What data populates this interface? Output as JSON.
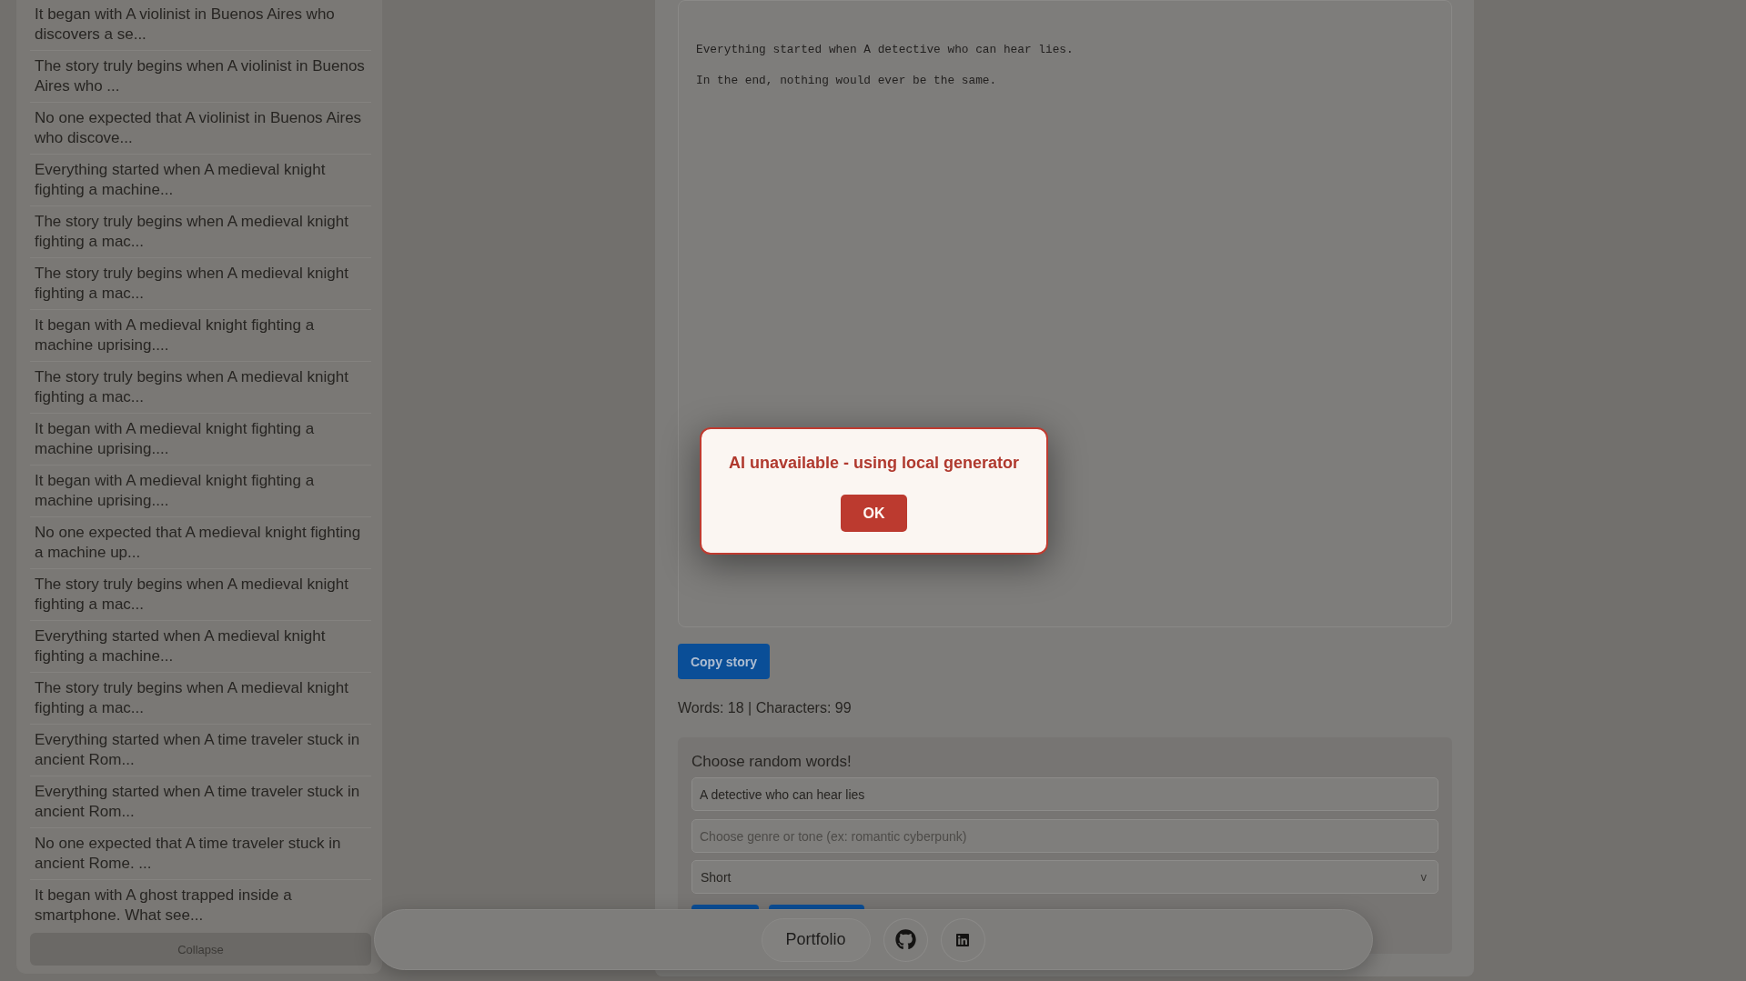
{
  "sidebar": {
    "items": [
      "It began with A violinist in Buenos Aires who discovers a se...",
      "The story truly begins when A violinist in Buenos Aires who ...",
      "No one expected that A violinist in Buenos Aires who discove...",
      "Everything started when A medieval knight fighting a machine...",
      "The story truly begins when A medieval knight fighting a mac...",
      "The story truly begins when A medieval knight fighting a mac...",
      "It began with A medieval knight fighting a machine uprising....",
      "The story truly begins when A medieval knight fighting a mac...",
      "It began with A medieval knight fighting a machine uprising....",
      "It began with A medieval knight fighting a machine uprising....",
      "No one expected that A medieval knight fighting a machine up...",
      "The story truly begins when A medieval knight fighting a mac...",
      "Everything started when A medieval knight fighting a machine...",
      "The story truly begins when A medieval knight fighting a mac...",
      "Everything started when A time traveler stuck in ancient Rom...",
      "Everything started when A time traveler stuck in ancient Rom...",
      "No one expected that A time traveler stuck in ancient Rome. ...",
      "It began with A ghost trapped inside a smartphone. What see..."
    ],
    "collapse_button": "Collapse"
  },
  "story": {
    "paragraphs": [
      "Everything started when A detective who can hear lies.",
      "In the end, nothing would ever be the same."
    ]
  },
  "copy_button": "Copy story",
  "stats": "Words: 18 | Characters: 99",
  "generator": {
    "title": "Choose random words!",
    "prompt_field": {
      "value": "A detective who can hear lies"
    },
    "genre_field": {
      "placeholder": "Choose genre or tone (ex: romantic cyberpunk)"
    },
    "length_select": {
      "value": "Short",
      "arrow": "v"
    }
  },
  "footer": {
    "links": [
      {
        "kind": "text",
        "label": "Portfolio"
      },
      {
        "kind": "github"
      },
      {
        "kind": "linkedin"
      }
    ]
  },
  "dialog": {
    "message": "AI unavailable - using local generator",
    "button": "OK"
  }
}
